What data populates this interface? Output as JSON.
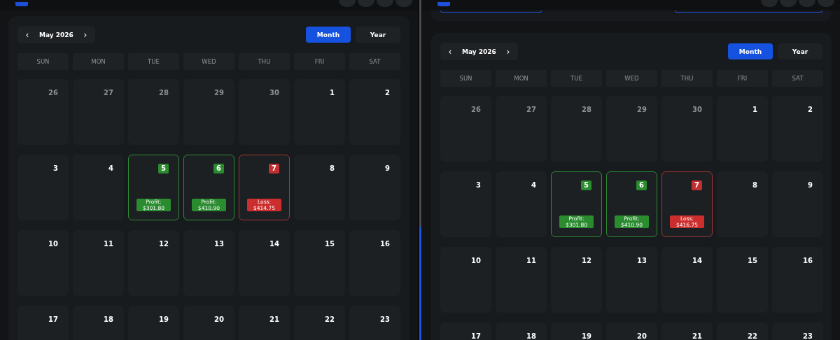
{
  "panels": [
    {
      "sections": [
        {
          "kind": "calendar",
          "month_label": "May 2026",
          "prev": "‹",
          "next": "›",
          "views": [
            {
              "label": "Month",
              "selected": true
            },
            {
              "label": "Year",
              "selected": false
            }
          ],
          "weekdays": [
            "SUN",
            "MON",
            "TUE",
            "WED",
            "THU",
            "FRI",
            "SAT"
          ],
          "weeks": [
            [
              {
                "day": "26",
                "muted": true
              },
              {
                "day": "27",
                "muted": true
              },
              {
                "day": "28",
                "muted": true
              },
              {
                "day": "29",
                "muted": true
              },
              {
                "day": "30",
                "muted": true
              },
              {
                "day": "1",
                "muted": false
              },
              {
                "day": "2",
                "muted": false
              }
            ],
            [
              {
                "day": "3",
                "muted": false
              },
              {
                "day": "4",
                "muted": false
              },
              {
                "day": "5",
                "muted": false,
                "kind": "profit",
                "result": "Profit:\n$301.80"
              },
              {
                "day": "6",
                "muted": false,
                "kind": "profit",
                "result": "Profit:\n$410.90"
              },
              {
                "day": "7",
                "muted": false,
                "kind": "loss",
                "result": "Loss:\n$414.75"
              },
              {
                "day": "8",
                "muted": false
              },
              {
                "day": "9",
                "muted": false
              }
            ],
            [
              {
                "day": "10",
                "muted": false
              },
              {
                "day": "11",
                "muted": false
              },
              {
                "day": "12",
                "muted": false
              },
              {
                "day": "13",
                "muted": false
              },
              {
                "day": "14",
                "muted": false
              },
              {
                "day": "15",
                "muted": false
              },
              {
                "day": "16",
                "muted": false
              }
            ],
            [
              {
                "day": "17",
                "muted": false
              },
              {
                "day": "18",
                "muted": false
              },
              {
                "day": "19",
                "muted": false
              },
              {
                "day": "20",
                "muted": false
              },
              {
                "day": "21",
                "muted": false
              },
              {
                "day": "22",
                "muted": false
              },
              {
                "day": "23",
                "muted": false
              }
            ]
          ]
        }
      ]
    },
    {
      "sections": [
        {
          "kind": "form-edge"
        },
        {
          "kind": "calendar",
          "month_label": "May 2026",
          "prev": "‹",
          "next": "›",
          "views": [
            {
              "label": "Month",
              "selected": true
            },
            {
              "label": "Year",
              "selected": false
            }
          ],
          "weekdays": [
            "SUN",
            "MON",
            "TUE",
            "WED",
            "THU",
            "FRI",
            "SAT"
          ],
          "weeks": [
            [
              {
                "day": "26",
                "muted": true
              },
              {
                "day": "27",
                "muted": true
              },
              {
                "day": "28",
                "muted": true
              },
              {
                "day": "29",
                "muted": true
              },
              {
                "day": "30",
                "muted": true
              },
              {
                "day": "1",
                "muted": false
              },
              {
                "day": "2",
                "muted": false
              }
            ],
            [
              {
                "day": "3",
                "muted": false
              },
              {
                "day": "4",
                "muted": false
              },
              {
                "day": "5",
                "muted": false,
                "kind": "profit",
                "result": "Profit:\n$301.80"
              },
              {
                "day": "6",
                "muted": false,
                "kind": "profit",
                "result": "Profit:\n$410.90"
              },
              {
                "day": "7",
                "muted": false,
                "kind": "loss",
                "result": "Loss:\n$416.75"
              },
              {
                "day": "8",
                "muted": false
              },
              {
                "day": "9",
                "muted": false
              }
            ],
            [
              {
                "day": "10",
                "muted": false
              },
              {
                "day": "11",
                "muted": false
              },
              {
                "day": "12",
                "muted": false
              },
              {
                "day": "13",
                "muted": false
              },
              {
                "day": "14",
                "muted": false
              },
              {
                "day": "15",
                "muted": false
              },
              {
                "day": "16",
                "muted": false
              }
            ],
            [
              {
                "day": "17",
                "muted": false
              },
              {
                "day": "18",
                "muted": false
              },
              {
                "day": "19",
                "muted": false
              },
              {
                "day": "20",
                "muted": false
              },
              {
                "day": "21",
                "muted": false
              },
              {
                "day": "22",
                "muted": false
              },
              {
                "day": "23",
                "muted": false
              }
            ]
          ]
        }
      ]
    }
  ]
}
